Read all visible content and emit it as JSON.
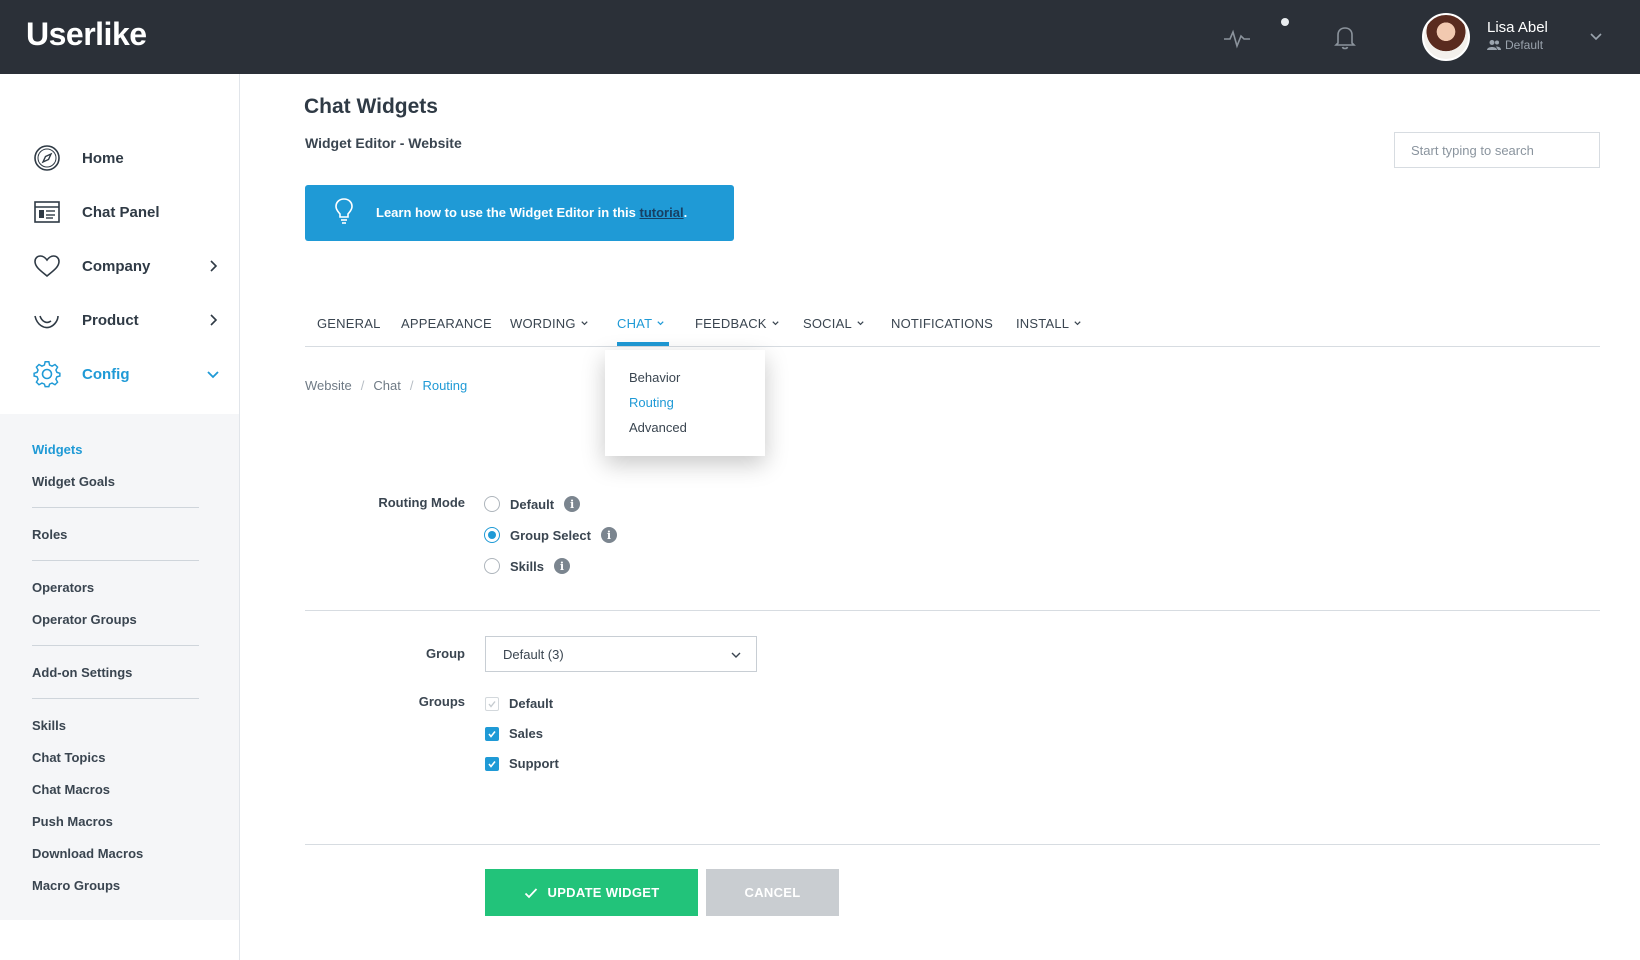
{
  "topbar": {
    "logo": "Userlike",
    "user_name": "Lisa Abel",
    "user_role": "Default"
  },
  "sidebar": {
    "items": [
      {
        "label": "Home",
        "icon": "compass-icon"
      },
      {
        "label": "Chat Panel",
        "icon": "chat-panel-icon"
      },
      {
        "label": "Company",
        "icon": "heart-icon"
      },
      {
        "label": "Product",
        "icon": "smile-icon"
      },
      {
        "label": "Config",
        "icon": "gear-icon"
      }
    ],
    "subitems": [
      "Widgets",
      "Widget Goals",
      "Roles",
      "Operators",
      "Operator Groups",
      "Add-on Settings",
      "Skills",
      "Chat Topics",
      "Chat Macros",
      "Push Macros",
      "Download Macros",
      "Macro Groups"
    ]
  },
  "main": {
    "title": "Chat Widgets",
    "subtitle": "Widget Editor - Website",
    "search_placeholder": "Start typing to search",
    "tip": {
      "text_before": "Learn how to use the Widget Editor in this ",
      "link": "tutorial",
      "text_after": "."
    },
    "tabs": [
      "GENERAL",
      "APPEARANCE",
      "WORDING",
      "CHAT",
      "FEEDBACK",
      "SOCIAL",
      "NOTIFICATIONS",
      "INSTALL"
    ],
    "chat_menu": [
      "Behavior",
      "Routing",
      "Advanced"
    ],
    "breadcrumb": [
      "Website",
      "Chat",
      "Routing"
    ],
    "routing": {
      "label": "Routing Mode",
      "options": [
        "Default",
        "Group Select",
        "Skills"
      ],
      "selected": "Group Select"
    },
    "group": {
      "label": "Group",
      "value": "Default (3)"
    },
    "groups": {
      "label": "Groups",
      "items": [
        "Default",
        "Sales",
        "Support"
      ]
    },
    "buttons": {
      "update": "UPDATE WIDGET",
      "cancel": "CANCEL"
    }
  },
  "colors": {
    "topbar": "#2b3038",
    "accent": "#1f9ad6",
    "success": "#22c37a",
    "disabled": "#c9cdd1"
  }
}
